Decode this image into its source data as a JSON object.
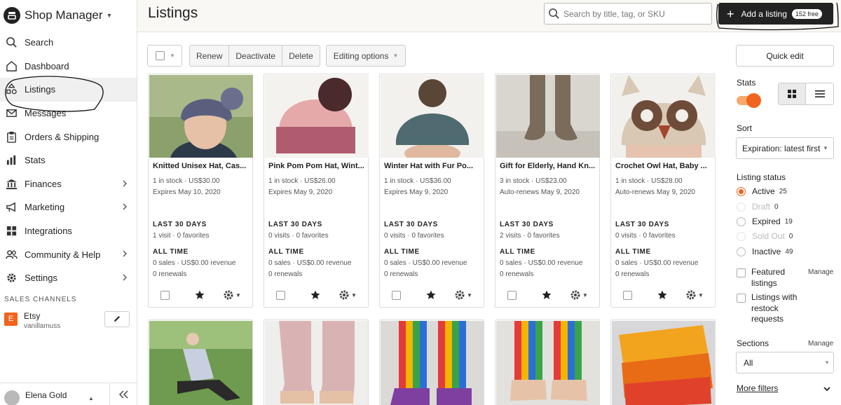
{
  "app": {
    "title": "Shop Manager",
    "page_title": "Listings"
  },
  "sidebar": {
    "items": [
      {
        "label": "Search",
        "icon": "search-icon"
      },
      {
        "label": "Dashboard",
        "icon": "home-icon"
      },
      {
        "label": "Listings",
        "icon": "shapes-icon",
        "active": true
      },
      {
        "label": "Messages",
        "icon": "mail-icon"
      },
      {
        "label": "Orders & Shipping",
        "icon": "clipboard-icon"
      },
      {
        "label": "Stats",
        "icon": "bar-chart-icon"
      },
      {
        "label": "Finances",
        "icon": "bank-icon",
        "has_submenu": true
      },
      {
        "label": "Marketing",
        "icon": "megaphone-icon",
        "has_submenu": true
      },
      {
        "label": "Integrations",
        "icon": "grid-icon"
      },
      {
        "label": "Community & Help",
        "icon": "people-icon",
        "has_submenu": true
      },
      {
        "label": "Settings",
        "icon": "gear-icon",
        "has_submenu": true
      }
    ],
    "sales_channels_title": "SALES CHANNELS",
    "channel": {
      "badge": "E",
      "name": "Etsy",
      "shop": "vanillamuss"
    },
    "user": {
      "name": "Elena Gold"
    }
  },
  "header": {
    "search_placeholder": "Search by title, tag, or SKU",
    "add_listing_label": "Add a listing",
    "free_badge": "152 free"
  },
  "toolbar": {
    "renew": "Renew",
    "deactivate": "Deactivate",
    "delete": "Delete",
    "editing_options": "Editing options"
  },
  "listings": [
    {
      "title": "Knitted Unisex Hat, Cas...",
      "stock_price": "1 in stock  ·  US$30.00",
      "expiry": "Expires May 10, 2020",
      "last30_label": "LAST 30 DAYS",
      "last30": "1 visit  ·  0 favorites",
      "alltime_label": "ALL TIME",
      "alltime": "0 sales  ·  US$0.00 revenue",
      "renewals": "0 renewals"
    },
    {
      "title": "Pink Pom Pom Hat, Wint...",
      "stock_price": "1 in stock  ·  US$26.00",
      "expiry": "Expires May 9, 2020",
      "last30_label": "LAST 30 DAYS",
      "last30": "0 visits  ·  0 favorites",
      "alltime_label": "ALL TIME",
      "alltime": "0 sales  ·  US$0.00 revenue",
      "renewals": "0 renewals"
    },
    {
      "title": "Winter Hat with Fur Po...",
      "stock_price": "1 in stock  ·  US$36.00",
      "expiry": "Expires May 9, 2020",
      "last30_label": "LAST 30 DAYS",
      "last30": "0 visits  ·  0 favorites",
      "alltime_label": "ALL TIME",
      "alltime": "0 sales  ·  US$0.00 revenue",
      "renewals": "0 renewals"
    },
    {
      "title": "Gift for Elderly, Hand Kn...",
      "stock_price": "3 in stock  ·  US$23.00",
      "expiry": "Auto-renews May 9, 2020",
      "last30_label": "LAST 30 DAYS",
      "last30": "2 visits  ·  0 favorites",
      "alltime_label": "ALL TIME",
      "alltime": "0 sales  ·  US$0.00 revenue",
      "renewals": "0 renewals"
    },
    {
      "title": "Crochet Owl Hat, Baby ...",
      "stock_price": "1 in stock  ·  US$28.00",
      "expiry": "Auto-renews May 9, 2020",
      "last30_label": "LAST 30 DAYS",
      "last30": "0 visits  ·  0 favorites",
      "alltime_label": "ALL TIME",
      "alltime": "0 sales  ·  US$0.00 revenue",
      "renewals": "0 renewals"
    }
  ],
  "right_panel": {
    "quick_edit": "Quick edit",
    "stats_label": "Stats",
    "stats_enabled": true,
    "sort_label": "Sort",
    "sort_value": "Expiration: latest first",
    "status_label": "Listing status",
    "statuses": [
      {
        "label": "Active",
        "count": "25",
        "checked": true,
        "disabled": false
      },
      {
        "label": "Draft",
        "count": "0",
        "checked": false,
        "disabled": true
      },
      {
        "label": "Expired",
        "count": "19",
        "checked": false,
        "disabled": false
      },
      {
        "label": "Sold Out",
        "count": "0",
        "checked": false,
        "disabled": true
      },
      {
        "label": "Inactive",
        "count": "49",
        "checked": false,
        "disabled": false
      }
    ],
    "featured": "Featured listings",
    "restock": "Listings with restock requests",
    "manage": "Manage",
    "sections_label": "Sections",
    "sections_value": "All",
    "more_filters": "More filters"
  },
  "colors": {
    "accent": "#f1641e",
    "dark": "#222222",
    "header_bg": "#faf8f5"
  }
}
